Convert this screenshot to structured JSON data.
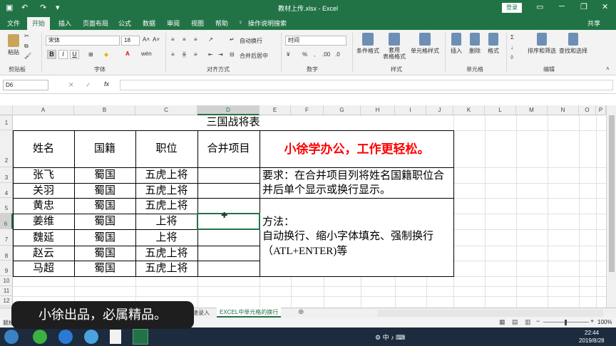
{
  "titlebar": {
    "title": "教材上传.xlsx  -  Excel",
    "login": "登录"
  },
  "tabs": [
    "文件",
    "开始",
    "插入",
    "页面布局",
    "公式",
    "数据",
    "审阅",
    "视图",
    "帮助"
  ],
  "tell_me": "操作说明搜索",
  "share": "共享",
  "ribbon": {
    "paste": "粘贴",
    "font_name": "宋体",
    "font_size": "18",
    "wrap_text": "自动换行",
    "merge_center": "合并后居中",
    "number_format": "时间",
    "conditional_format": "条件格式",
    "table_format": "套用\n表格格式",
    "cell_styles": "单元格样式",
    "insert": "插入",
    "delete": "删除",
    "format": "格式",
    "sort_filter": "排序和筛选",
    "find_select": "查找和选择",
    "groups": {
      "clipboard": "剪贴板",
      "font": "字体",
      "alignment": "对齐方式",
      "number": "数字",
      "styles": "样式",
      "cells": "单元格",
      "editing": "编辑"
    }
  },
  "namebox": "D6",
  "columns": [
    "A",
    "B",
    "C",
    "D",
    "E",
    "F",
    "G",
    "H",
    "I",
    "J",
    "K",
    "L",
    "M",
    "N",
    "O",
    "P"
  ],
  "rows": [
    "1",
    "2",
    "3",
    "4",
    "5",
    "6",
    "7",
    "8",
    "9",
    "10",
    "11",
    "12"
  ],
  "sheet": {
    "title": "三国战将表",
    "headers": [
      "姓名",
      "国籍",
      "职位",
      "合并项目"
    ],
    "data": [
      [
        "张飞",
        "蜀国",
        "五虎上将",
        ""
      ],
      [
        "关羽",
        "蜀国",
        "五虎上将",
        ""
      ],
      [
        "黄忠",
        "蜀国",
        "五虎上将",
        ""
      ],
      [
        "姜维",
        "蜀国",
        "上将",
        ""
      ],
      [
        "魏延",
        "蜀国",
        "上将",
        ""
      ],
      [
        "赵云",
        "蜀国",
        "五虎上将",
        ""
      ],
      [
        "马超",
        "蜀国",
        "五虎上将",
        ""
      ]
    ],
    "slogan": "小徐学办公，工作更轻松。",
    "requirement": "要求：在合并项目列将姓名国籍职位合并后单个显示或换行显示。",
    "method_title": "方法：",
    "method_body": "自动换行、缩小字体填充、强制换行（ATL+ENTER)等"
  },
  "sheet_tabs": [
    "速录入",
    "EXCEL中单元格的换行"
  ],
  "status": {
    "left": "就绪",
    "zoom": "100%"
  },
  "taskbar": {
    "time": "22:44",
    "date": "2019/8/28"
  },
  "overlay": "小徐出品，必属精品。",
  "colors": {
    "brand": "#217346",
    "slogan": "#ff0000"
  }
}
